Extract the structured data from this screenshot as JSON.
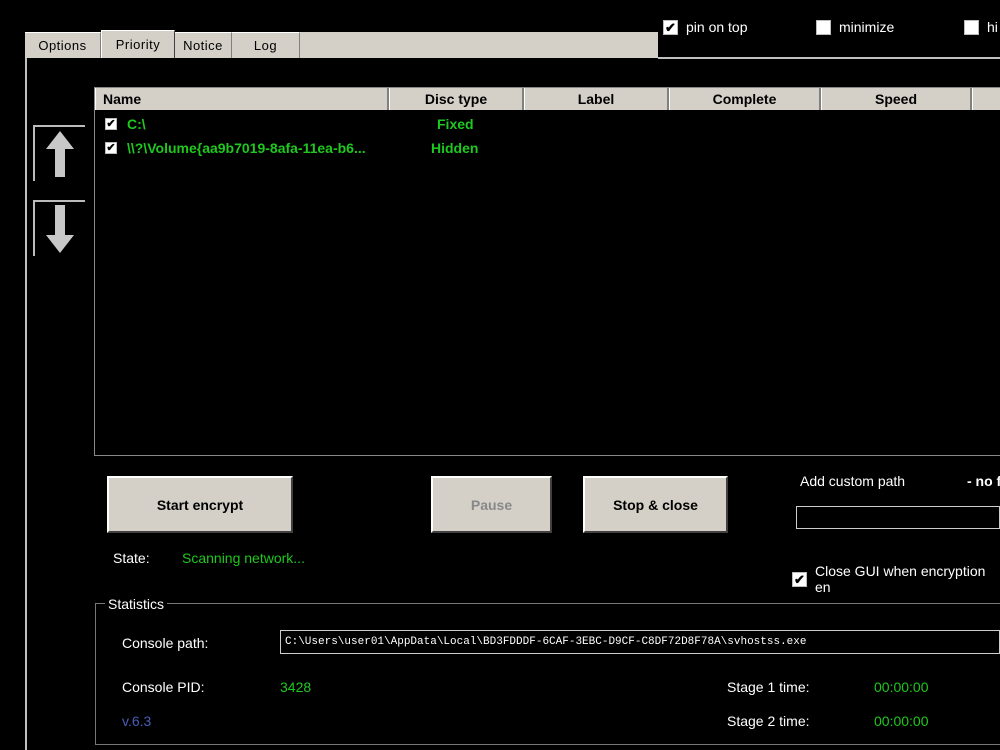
{
  "top_options": {
    "pin_on_top": {
      "label": "pin on top",
      "checked": true
    },
    "minimize": {
      "label": "minimize",
      "checked": false
    },
    "hide": {
      "label": "hi",
      "checked": false
    }
  },
  "tabs": [
    {
      "label": "Options"
    },
    {
      "label": "Priority",
      "active": true
    },
    {
      "label": "Notice"
    },
    {
      "label": "Log"
    }
  ],
  "listview": {
    "columns": [
      "Name",
      "Disc type",
      "Label",
      "Complete",
      "Speed"
    ],
    "rows": [
      {
        "checked": true,
        "name": "C:\\",
        "disc_type": "Fixed"
      },
      {
        "checked": true,
        "name": "\\\\?\\Volume{aa9b7019-8afa-11ea-b6...",
        "disc_type": "Hidden"
      }
    ]
  },
  "buttons": {
    "start": "Start encrypt",
    "pause": "Pause",
    "stop": "Stop & close"
  },
  "custom_path": {
    "label": "Add custom path",
    "status": "- no f"
  },
  "state": {
    "label": "State:",
    "value": "Scanning network..."
  },
  "close_gui": {
    "label": "Close GUI when encryption en",
    "checked": true
  },
  "statistics": {
    "title": "Statistics",
    "console_path_label": "Console path:",
    "console_path_value": "C:\\Users\\user01\\AppData\\Local\\BD3FDDDF-6CAF-3EBC-D9CF-C8DF72D8F78A\\svhostss.exe",
    "console_pid_label": "Console PID:",
    "console_pid_value": "3428",
    "version": "v.6.3",
    "stage1_label": "Stage 1 time:",
    "stage1_value": "00:00:00",
    "stage2_label": "Stage 2 time:",
    "stage2_value": "00:00:00"
  },
  "colors": {
    "background": "#000000",
    "accent_green": "#1ec81e",
    "panel_gray": "#d4d0c8",
    "version_blue": "#4a5db8"
  }
}
